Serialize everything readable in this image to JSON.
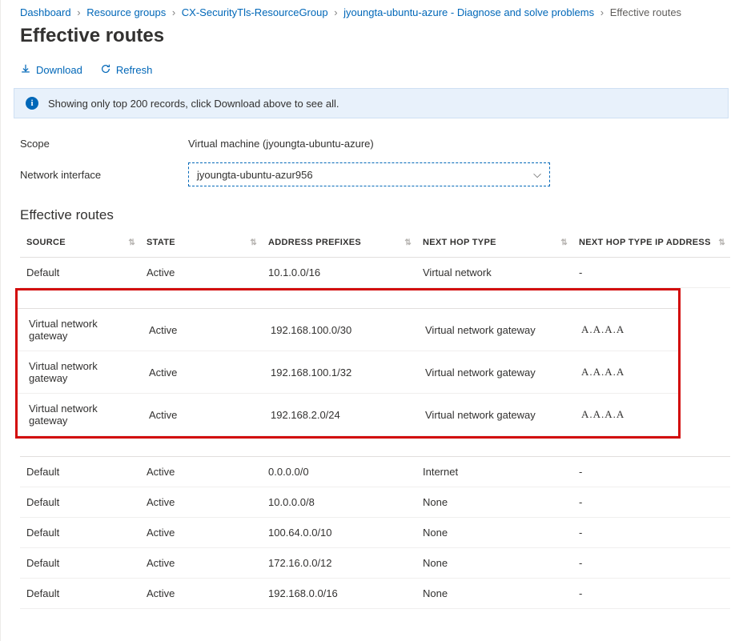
{
  "breadcrumb": {
    "items": [
      {
        "label": "Dashboard"
      },
      {
        "label": "Resource groups"
      },
      {
        "label": "CX-SecurityTls-ResourceGroup"
      },
      {
        "label": "jyoungta-ubuntu-azure - Diagnose and solve problems"
      }
    ],
    "current": "Effective routes"
  },
  "pageTitle": "Effective routes",
  "toolbar": {
    "download": "Download",
    "refresh": "Refresh"
  },
  "infoBar": {
    "text": "Showing only top 200 records, click Download above to see all."
  },
  "form": {
    "scopeLabel": "Scope",
    "scopeValue": "Virtual machine (jyoungta-ubuntu-azure)",
    "nicLabel": "Network interface",
    "nicValue": "jyoungta-ubuntu-azur956"
  },
  "tableTitle": "Effective routes",
  "columns": {
    "source": "SOURCE",
    "state": "STATE",
    "prefix": "ADDRESS PREFIXES",
    "next": "NEXT HOP TYPE",
    "ip": "NEXT HOP TYPE IP ADDRESS"
  },
  "rowsBefore": [
    {
      "source": "Default",
      "state": "Active",
      "prefix": "10.1.0.0/16",
      "next": "Virtual network",
      "ip": "-"
    }
  ],
  "rowsHighlighted": [
    {
      "source": "Virtual network gateway",
      "state": "Active",
      "prefix": "192.168.100.0/30",
      "next": "Virtual network gateway",
      "ip": "A.A.A.A"
    },
    {
      "source": "Virtual network gateway",
      "state": "Active",
      "prefix": "192.168.100.1/32",
      "next": "Virtual network gateway",
      "ip": "A.A.A.A"
    },
    {
      "source": "Virtual network gateway",
      "state": "Active",
      "prefix": "192.168.2.0/24",
      "next": "Virtual network gateway",
      "ip": "A.A.A.A"
    }
  ],
  "rowsAfter": [
    {
      "source": "Default",
      "state": "Active",
      "prefix": "0.0.0.0/0",
      "next": "Internet",
      "ip": "-"
    },
    {
      "source": "Default",
      "state": "Active",
      "prefix": "10.0.0.0/8",
      "next": "None",
      "ip": "-"
    },
    {
      "source": "Default",
      "state": "Active",
      "prefix": "100.64.0.0/10",
      "next": "None",
      "ip": "-"
    },
    {
      "source": "Default",
      "state": "Active",
      "prefix": "172.16.0.0/12",
      "next": "None",
      "ip": "-"
    },
    {
      "source": "Default",
      "state": "Active",
      "prefix": "192.168.0.0/16",
      "next": "None",
      "ip": "-"
    }
  ]
}
